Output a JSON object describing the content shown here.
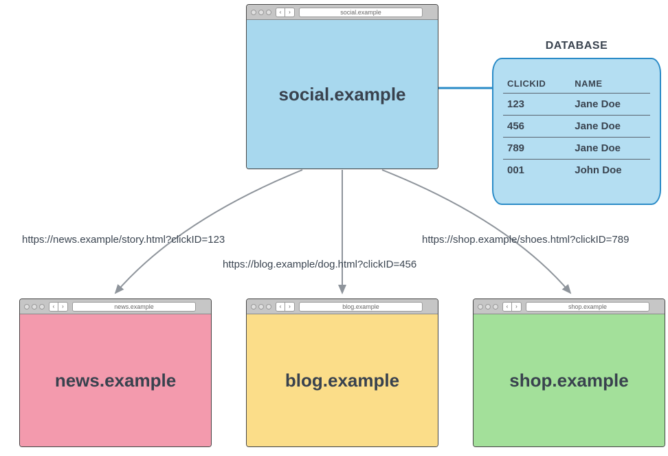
{
  "top_browser": {
    "url": "social.example",
    "site_label": "social.example",
    "bg": "#a8d8ee"
  },
  "database": {
    "title": "DATABASE",
    "columns": [
      "CLICKID",
      "NAME"
    ],
    "rows": [
      {
        "clickid": "123",
        "name": "Jane Doe"
      },
      {
        "clickid": "456",
        "name": "Jane Doe"
      },
      {
        "clickid": "789",
        "name": "Jane Doe"
      },
      {
        "clickid": "001",
        "name": "John Doe"
      }
    ]
  },
  "connections": [
    {
      "label": "https://news.example/story.html?clickID=123"
    },
    {
      "label": "https://blog.example/dog.html?clickID=456"
    },
    {
      "label": "https://shop.example/shoes.html?clickID=789"
    }
  ],
  "bottom_browsers": [
    {
      "url": "news.example",
      "site_label": "news.example",
      "bg": "#f39aad"
    },
    {
      "url": "blog.example",
      "site_label": "blog.example",
      "bg": "#fbdd89"
    },
    {
      "url": "shop.example",
      "site_label": "shop.example",
      "bg": "#a3e09a"
    }
  ]
}
